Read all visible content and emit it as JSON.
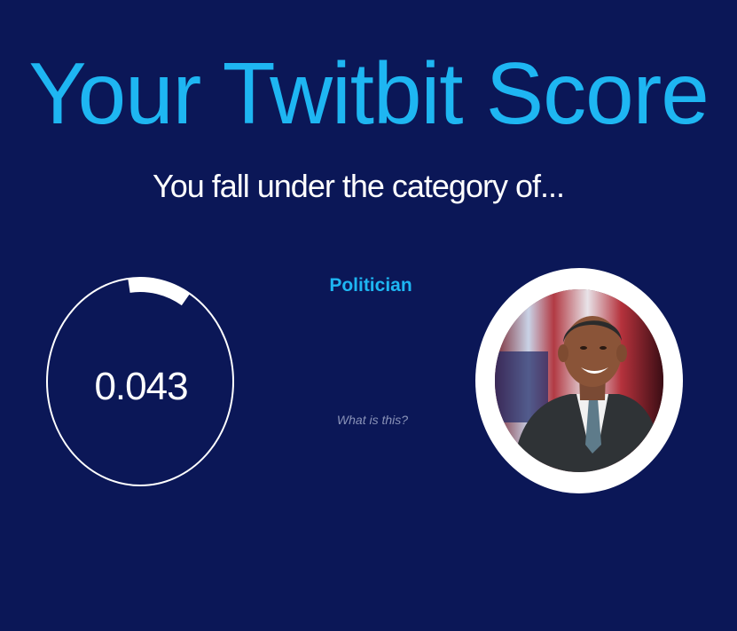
{
  "header": {
    "title": "Your Twitbit Score",
    "subtitle": "You fall under the category of..."
  },
  "score": {
    "value": "0.043",
    "progress_fraction": 0.043,
    "ring_color": "#ffffff"
  },
  "category": {
    "label": "Politician",
    "help_link": "What is this?"
  },
  "avatar": {
    "icon": "person-portrait-icon"
  },
  "colors": {
    "background": "#0b1757",
    "accent": "#1eb6f2",
    "text": "#ffffff",
    "muted": "#8a93b8"
  }
}
